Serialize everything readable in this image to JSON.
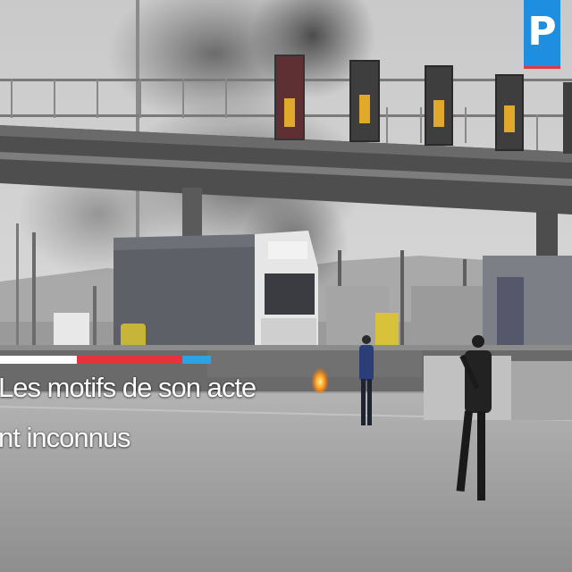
{
  "video": {
    "logo_letter": "P",
    "caption_lines": [
      "Les motifs de son acte",
      "nt inconnus"
    ]
  },
  "colors": {
    "logo_bg": "#1e8fe0",
    "rule_white": "#ffffff",
    "rule_red": "#e2343a",
    "rule_blue": "#2ea3e0",
    "fire": "#ff9a1a"
  }
}
